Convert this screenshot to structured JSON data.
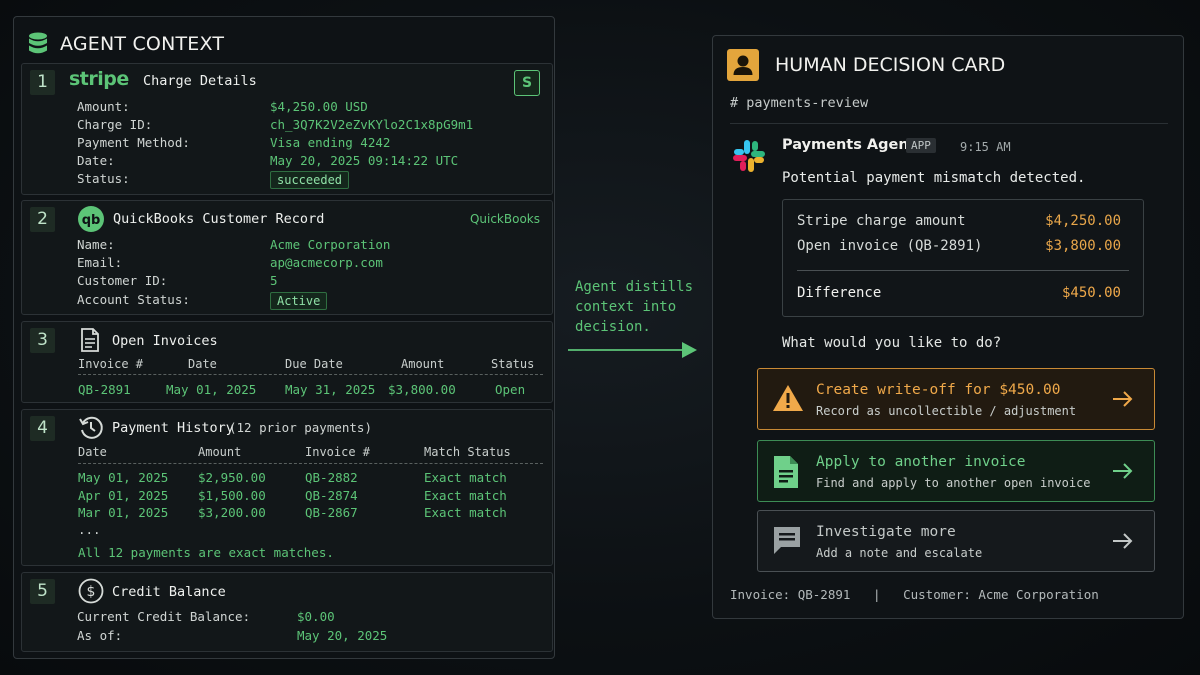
{
  "agent_context": {
    "title": "AGENT CONTEXT",
    "sections": {
      "stripe": {
        "number": "1",
        "brand": "stripe",
        "title": "Charge Details",
        "badge": "S",
        "rows": [
          {
            "label": "Amount:",
            "value": "$4,250.00 USD"
          },
          {
            "label": "Charge ID:",
            "value": "ch_3Q7K2V2eZvKYlo2C1x8pG9m1"
          },
          {
            "label": "Payment Method:",
            "value": "Visa ending 4242"
          },
          {
            "label": "Date:",
            "value": "May 20, 2025 09:14:22 UTC"
          },
          {
            "label": "Status:",
            "value": "succeeded"
          }
        ]
      },
      "quickbooks": {
        "number": "2",
        "title": "QuickBooks Customer Record",
        "brand": "QuickBooks",
        "rows": [
          {
            "label": "Name:",
            "value": "Acme Corporation"
          },
          {
            "label": "Email:",
            "value": "ap@acmecorp.com"
          },
          {
            "label": "Customer ID:",
            "value": "5"
          },
          {
            "label": "Account Status:",
            "value": "Active"
          }
        ]
      },
      "invoices": {
        "number": "3",
        "title": "Open Invoices",
        "columns": [
          "Invoice #",
          "Date",
          "Due Date",
          "Amount",
          "Status"
        ],
        "rows": [
          [
            "QB-2891",
            "May 01, 2025",
            "May 31, 2025",
            "$3,800.00",
            "Open"
          ]
        ]
      },
      "history": {
        "number": "4",
        "title": "Payment History",
        "subtitle": "(12 prior payments)",
        "columns": [
          "Date",
          "Amount",
          "Invoice #",
          "Match Status"
        ],
        "rows": [
          [
            "May 01, 2025",
            "$2,950.00",
            "QB-2882",
            "Exact match"
          ],
          [
            "Apr 01, 2025",
            "$1,500.00",
            "QB-2874",
            "Exact match"
          ],
          [
            "Mar 01, 2025",
            "$3,200.00",
            "QB-2867",
            "Exact match"
          ]
        ],
        "ellipsis": "...",
        "note": "All 12 payments are exact matches."
      },
      "credit": {
        "number": "5",
        "title": "Credit Balance",
        "rows": [
          {
            "label": "Current Credit Balance:",
            "value": "$0.00"
          },
          {
            "label": "As of:",
            "value": "May 20, 2025"
          }
        ]
      }
    }
  },
  "arrow_text": [
    "Agent distills",
    "context into",
    "decision."
  ],
  "decision_card": {
    "title": "HUMAN DECISION CARD",
    "channel": "# payments-review",
    "message": {
      "sender": "Payments Agent",
      "badge": "APP",
      "time": "9:15 AM",
      "text": "Potential payment mismatch detected."
    },
    "summary": {
      "stripe_label": "Stripe charge amount",
      "stripe_value": "$4,250.00",
      "invoice_label": "Open invoice (QB-2891)",
      "invoice_value": "$3,800.00",
      "diff_label": "Difference",
      "diff_value": "$450.00"
    },
    "question": "What would you like to do?",
    "actions": [
      {
        "title": "Create write-off for $450.00",
        "subtitle": "Record as uncollectible / adjustment",
        "icon": "warning-icon"
      },
      {
        "title": "Apply to another invoice",
        "subtitle": "Find and apply to another open invoice",
        "icon": "document-icon"
      },
      {
        "title": "Investigate more",
        "subtitle": "Add a note and escalate",
        "icon": "comment-icon"
      }
    ],
    "footer": {
      "invoice": "Invoice: QB-2891",
      "separator": "|",
      "customer": "Customer: Acme Corporation"
    }
  },
  "colors": {
    "accent_green": "#5cc477",
    "accent_orange": "#f0a94a",
    "card_icon": "#e3a53c"
  }
}
